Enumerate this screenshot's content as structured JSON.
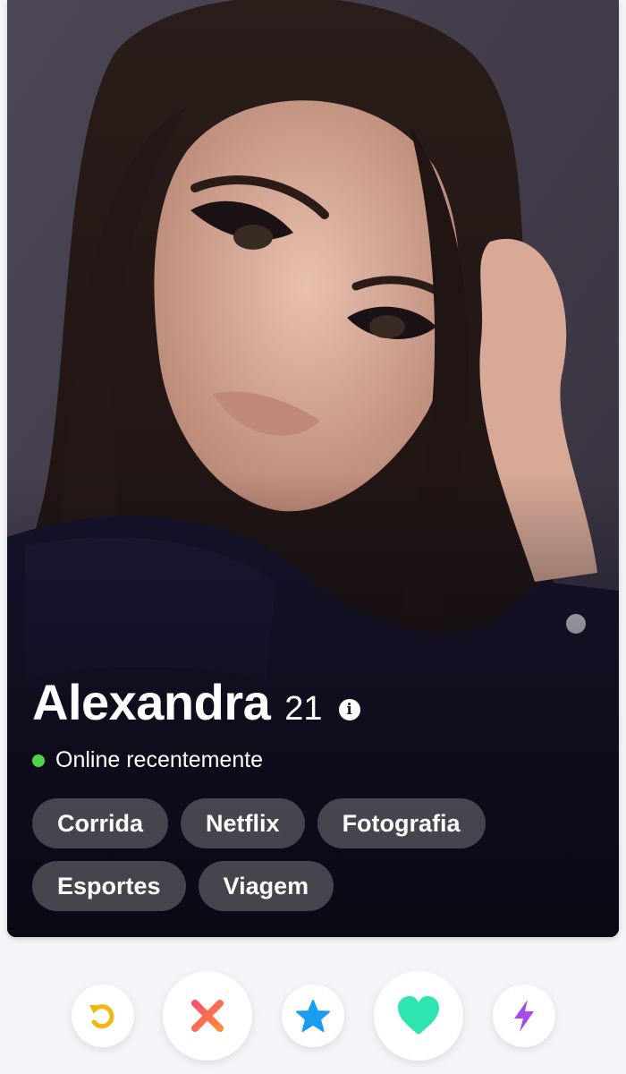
{
  "profile": {
    "name": "Alexandra",
    "age": "21",
    "info_icon": "i",
    "status": "Online recentemente",
    "interests": [
      "Corrida",
      "Netflix",
      "Fotografia",
      "Esportes",
      "Viagem"
    ]
  },
  "actions": {
    "rewind": "rewind-icon",
    "nope": "close-icon",
    "super_like": "star-icon",
    "like": "heart-icon",
    "boost": "lightning-icon"
  },
  "colors": {
    "rewind": "#f5b70d",
    "nope_start": "#fd5068",
    "nope_end": "#ff8a3d",
    "super_like": "#1a9cf0",
    "like": "#2ee5b0",
    "boost": "#a34de8",
    "online": "#4fd24c"
  }
}
